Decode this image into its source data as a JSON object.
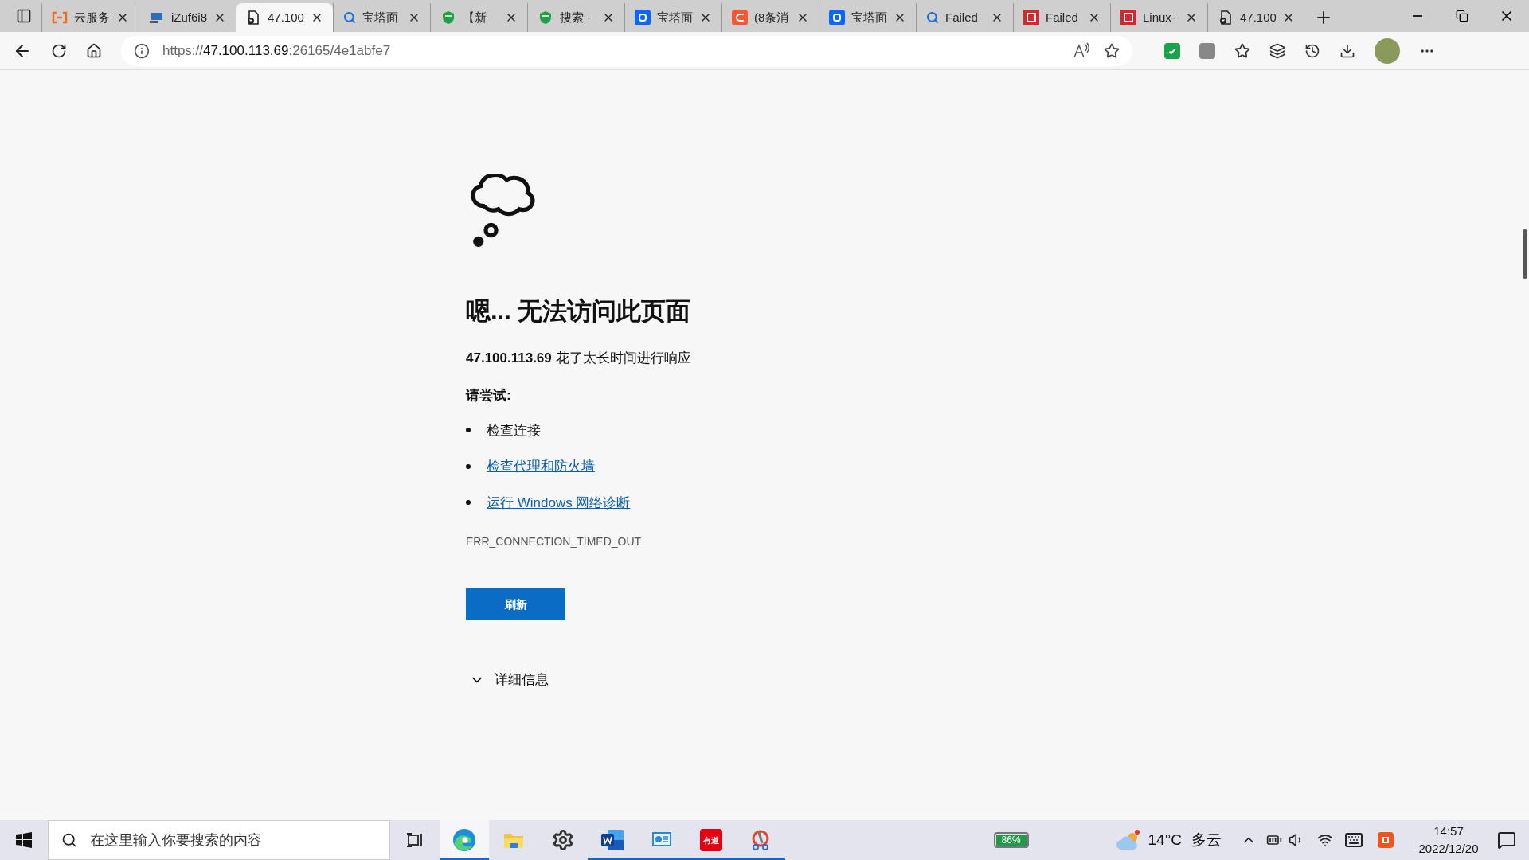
{
  "tabs": [
    {
      "kind": "bracket",
      "title": "云服务",
      "selected": false
    },
    {
      "kind": "monitor",
      "title": "iZuf6i8",
      "selected": false
    },
    {
      "kind": "error",
      "title": "47.100",
      "selected": true
    },
    {
      "kind": "search",
      "title": "宝塔面",
      "selected": false
    },
    {
      "kind": "shield",
      "title": "【新",
      "selected": false
    },
    {
      "kind": "shield",
      "title": "搜索 -",
      "selected": false
    },
    {
      "kind": "zhi",
      "title": "宝塔面",
      "selected": false
    },
    {
      "kind": "csdn",
      "title": "(8条消",
      "selected": false
    },
    {
      "kind": "zhi",
      "title": "宝塔面",
      "selected": false
    },
    {
      "kind": "search",
      "title": "Failed",
      "selected": false
    },
    {
      "kind": "fiftyone",
      "title": "Failed",
      "selected": false
    },
    {
      "kind": "fiftyone",
      "title": "Linux-",
      "selected": false
    },
    {
      "kind": "error",
      "title": "47.100",
      "selected": false
    }
  ],
  "address_bar": {
    "scheme": "https://",
    "host": "47.100.113.69",
    "rest": ":26165/4e1abfe7"
  },
  "error_page": {
    "heading": "嗯... 无法访问此页面",
    "message_host": "47.100.113.69",
    "message": "花了太长时间进行响应",
    "try_label": "请尝试:",
    "suggestions": [
      {
        "kind": "text",
        "text": "检查连接"
      },
      {
        "kind": "link",
        "text": "检查代理和防火墙"
      },
      {
        "kind": "link",
        "text": "运行 Windows 网络诊断"
      }
    ],
    "error_code": "ERR_CONNECTION_TIMED_OUT",
    "refresh_button": "刷新",
    "details": "详细信息"
  },
  "taskbar": {
    "search_placeholder": "在这里输入你要搜索的内容",
    "apps": [
      {
        "kind": "taskview",
        "running": false,
        "active": false
      },
      {
        "kind": "edge",
        "running": true,
        "active": true
      },
      {
        "kind": "folder",
        "running": false,
        "active": false
      },
      {
        "kind": "gear",
        "running": false,
        "active": false
      },
      {
        "kind": "word",
        "running": true,
        "active": false
      },
      {
        "kind": "monitorapp",
        "running": true,
        "active": false
      },
      {
        "kind": "youdao",
        "text": "有道",
        "running": true,
        "active": false
      },
      {
        "kind": "paint",
        "running": true,
        "active": false
      }
    ],
    "battery_percent": "86%",
    "temperature": "14°C",
    "weather": "多云",
    "time": "14:57",
    "date": "2022/12/20"
  }
}
